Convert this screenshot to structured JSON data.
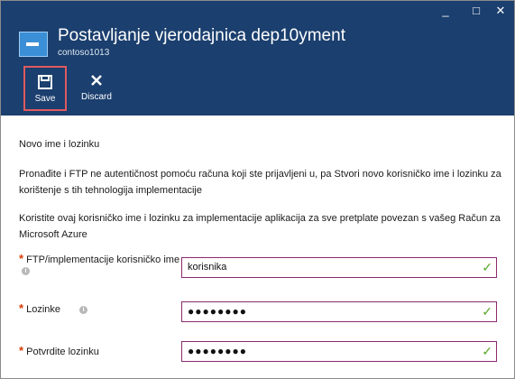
{
  "window": {
    "minimize_glyph": "_",
    "maximize_glyph": "□",
    "close_glyph": "✕"
  },
  "header": {
    "title": "Postavljanje vjerodajnica dep10yment",
    "subtitle": "contoso1013",
    "accent_color": "#1b3f6e"
  },
  "toolbar": {
    "save_label": "Save",
    "discard_label": "Discard"
  },
  "content": {
    "section_title": "Novo ime i lozinku",
    "paragraph1": "Pronađite i FTP ne autentičnost pomoću računa koji ste prijavljeni u, pa Stvori novo korisničko ime i lozinku za korištenje s tih tehnologija implementacije",
    "paragraph2": "Koristite ovaj korisničko ime i lozinku za implementacije aplikacija za sve pretplate povezan s vašeg Račun za Microsoft Azure"
  },
  "fields": {
    "required_marker": "*",
    "username": {
      "label": "FTP/implementacije korisničko ime",
      "value": "korisnika"
    },
    "password": {
      "label": "Lozinke",
      "value": "●●●●●●●●"
    },
    "confirm": {
      "label": "Potvrdite lozinku",
      "value": "●●●●●●●●"
    },
    "valid_glyph": "✓"
  }
}
